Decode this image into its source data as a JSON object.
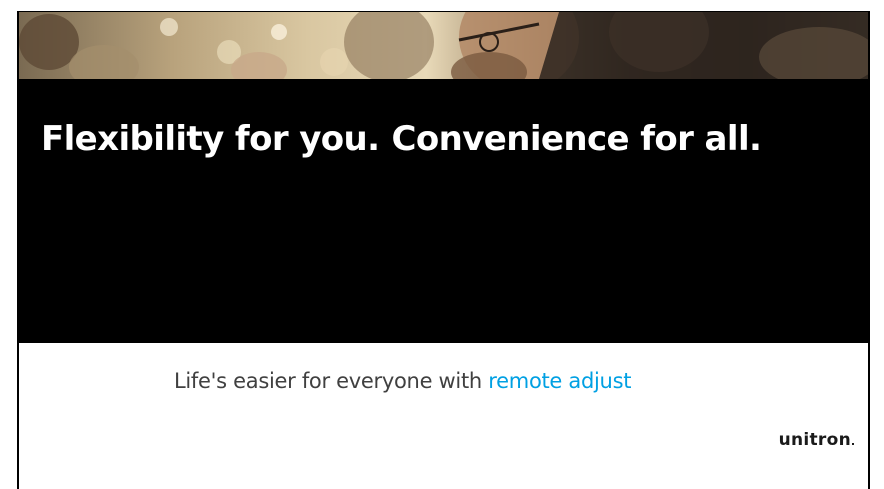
{
  "slide": {
    "headline_part1": "Flexibility for you.",
    "headline_part2": "Convenience for all.",
    "subline_prefix": "Life's easier for everyone with ",
    "subline_highlight": "remote adjust",
    "logo_text": "unitron",
    "highlight_color": "#00a0e3"
  }
}
